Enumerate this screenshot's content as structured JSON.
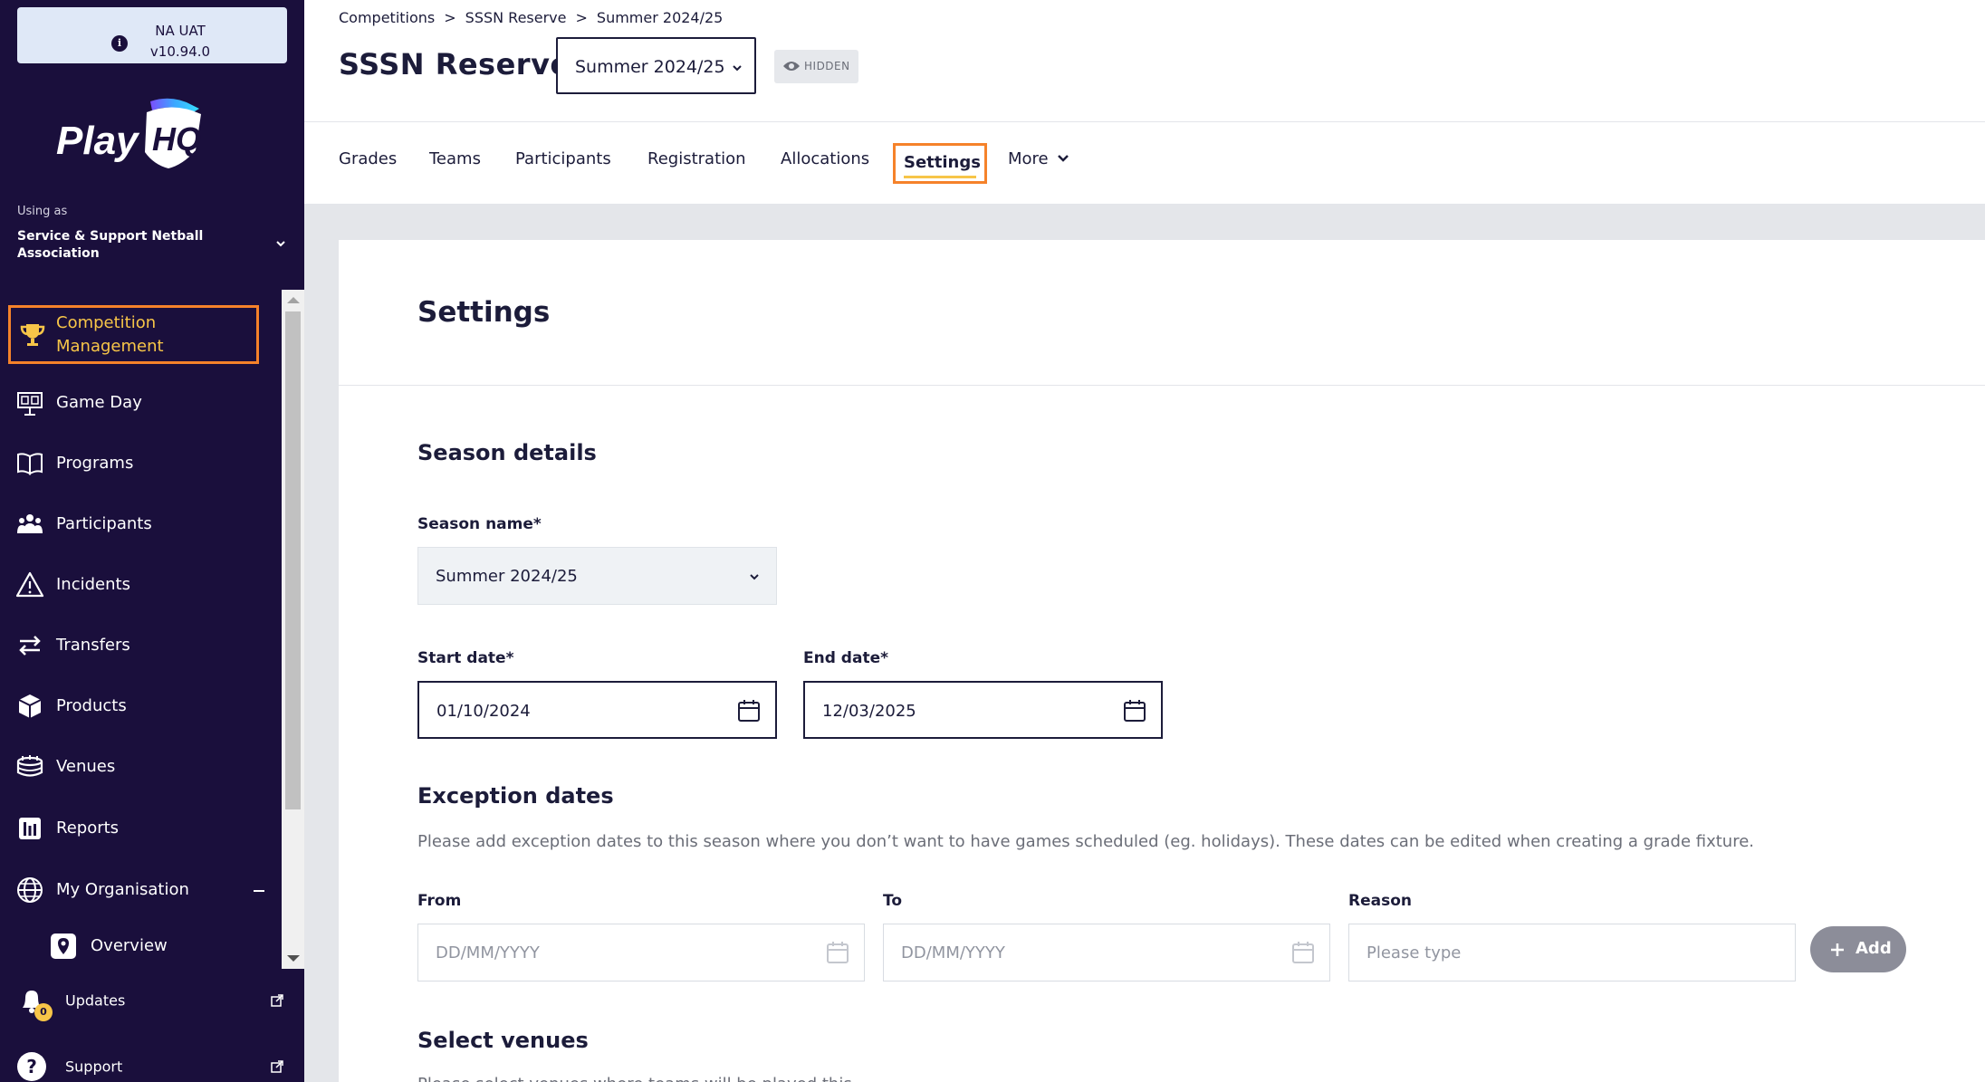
{
  "environment": {
    "name": "NA UAT",
    "version": "v10.94.0",
    "info_icon": "i"
  },
  "brand": {
    "logo_text": "PlayHQ"
  },
  "organisation": {
    "using_as_label": "Using as",
    "name": "Service & Support Netball Association"
  },
  "nav": {
    "items": [
      {
        "label": "Competition Management",
        "icon": "trophy-icon",
        "active": true
      },
      {
        "label": "Game Day",
        "icon": "scoreboard-icon"
      },
      {
        "label": "Programs",
        "icon": "book-icon"
      },
      {
        "label": "Participants",
        "icon": "people-icon"
      },
      {
        "label": "Incidents",
        "icon": "warning-icon"
      },
      {
        "label": "Transfers",
        "icon": "transfer-arrows-icon"
      },
      {
        "label": "Products",
        "icon": "boxes-icon"
      },
      {
        "label": "Venues",
        "icon": "stadium-icon"
      },
      {
        "label": "Reports",
        "icon": "report-icon"
      },
      {
        "label": "My Organisation",
        "icon": "globe-icon",
        "expanded": true
      },
      {
        "label": "Overview",
        "icon": "location-pin-icon",
        "sub": true
      }
    ],
    "utility": [
      {
        "label": "Updates",
        "icon": "bell-icon",
        "badge": "0"
      },
      {
        "label": "Support",
        "icon": "question-icon"
      }
    ]
  },
  "header": {
    "breadcrumb": [
      "Competitions",
      "SSSN Reserve",
      "Summer 2024/25"
    ],
    "breadcrumb_sep": ">",
    "title": "SSSN Reserve",
    "season_selector": "Summer 2024/25",
    "visibility_badge": "HIDDEN"
  },
  "tabs": [
    "Grades",
    "Teams",
    "Participants",
    "Registration",
    "Allocations",
    "Settings",
    "More"
  ],
  "active_tab": "Settings",
  "settings": {
    "title": "Settings",
    "season_details": {
      "heading": "Season details",
      "season_name_label": "Season name*",
      "season_name_value": "Summer 2024/25",
      "start_date_label": "Start date*",
      "start_date_value": "01/10/2024",
      "end_date_label": "End date*",
      "end_date_value": "12/03/2025"
    },
    "exception_dates": {
      "heading": "Exception dates",
      "description": "Please add exception dates to this season where you don’t want to have games scheduled (eg. holidays). These dates can be edited when creating a grade fixture.",
      "from_label": "From",
      "from_placeholder": "DD/MM/YYYY",
      "to_label": "To",
      "to_placeholder": "DD/MM/YYYY",
      "reason_label": "Reason",
      "reason_placeholder": "Please type",
      "add_button": "Add"
    },
    "venues": {
      "heading": "Select venues",
      "description_partial": "Please select venues where teams will be played this"
    }
  },
  "colors": {
    "sidebar_bg": "#1a0f3c",
    "highlight_outline": "#f5822a",
    "active_text": "#f7c548",
    "content_bg": "#e4e6ea"
  }
}
